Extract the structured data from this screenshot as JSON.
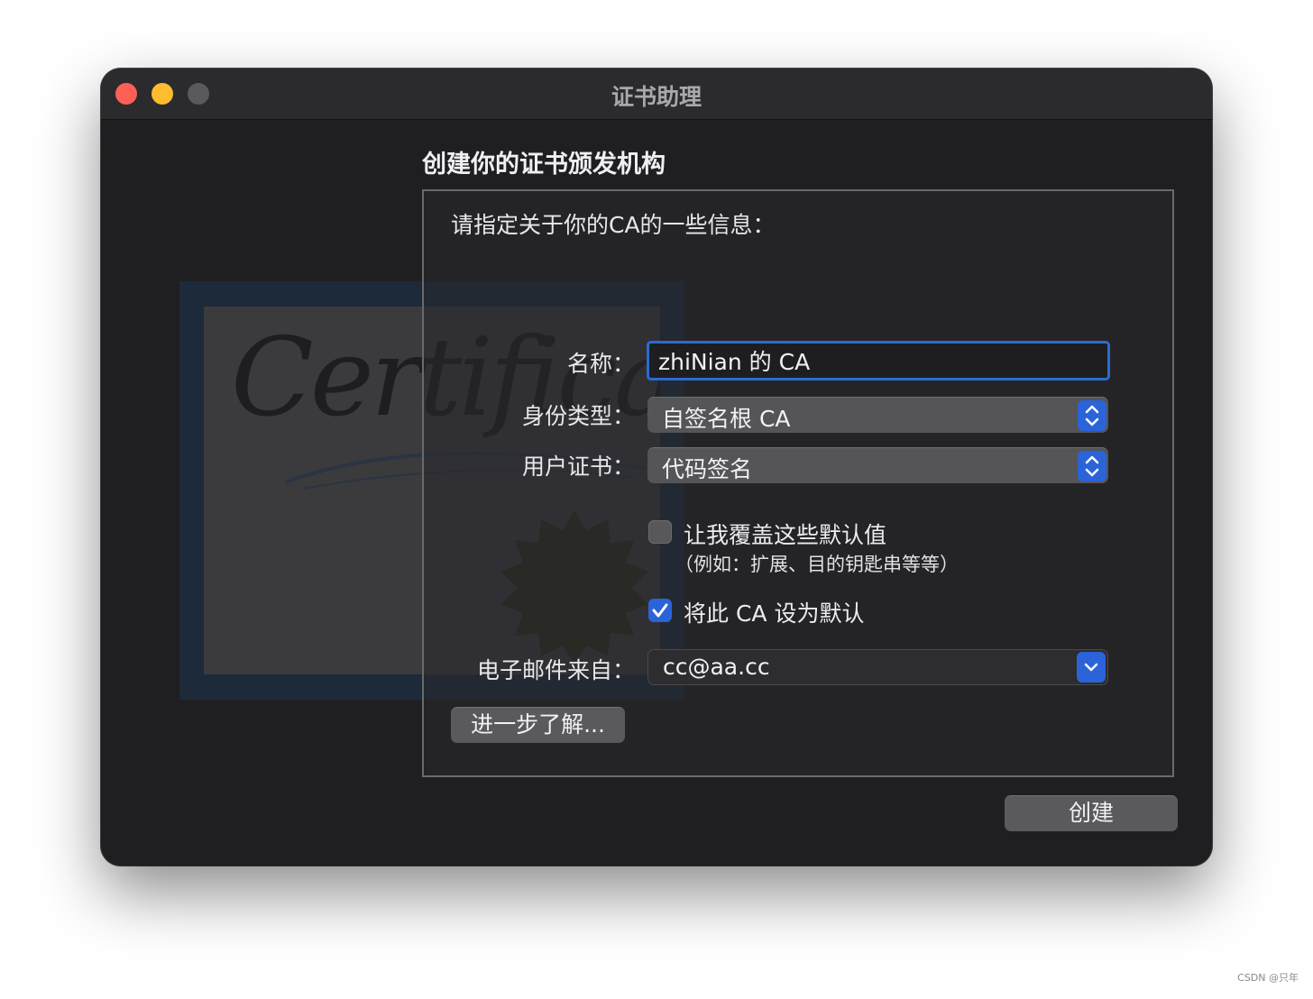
{
  "window": {
    "title": "证书助理"
  },
  "page": {
    "heading": "创建你的证书颁发机构",
    "intro": "请指定关于你的CA的一些信息："
  },
  "art": {
    "script_text": "Certificate"
  },
  "form": {
    "name_label": "名称：",
    "name_value": "zhiNian 的 CA",
    "identity_label": "身份类型：",
    "identity_value": "自签名根 CA",
    "usercert_label": "用户证书：",
    "usercert_value": "代码签名",
    "override_label": "让我覆盖这些默认值",
    "override_sub": "（例如：扩展、目的钥匙串等等）",
    "override_checked": false,
    "default_label": "将此 CA 设为默认",
    "default_checked": true,
    "email_label": "电子邮件来自：",
    "email_value": "cc@aa.cc"
  },
  "buttons": {
    "learn_more": "进一步了解...",
    "create": "创建"
  },
  "watermark": "CSDN @只年"
}
